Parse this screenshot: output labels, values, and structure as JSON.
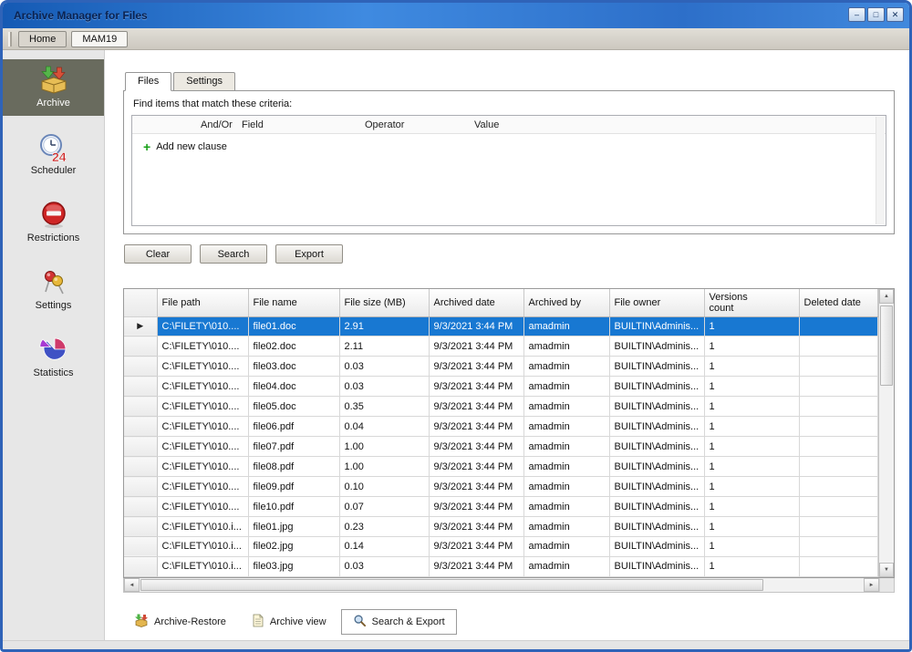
{
  "window": {
    "title": "Archive Manager for Files",
    "controls": {
      "minimize": "–",
      "maximize": "□",
      "close": "✕"
    }
  },
  "icons": {
    "scroll_up": "▲",
    "scroll_down": "▼",
    "scroll_left": "◄",
    "scroll_right": "►",
    "add_plus": "+",
    "selected_row_arrow": "▶"
  },
  "toolbar": {
    "items": [
      {
        "label": "Home"
      },
      {
        "label": "MAM19"
      }
    ]
  },
  "sidebar": {
    "items": [
      {
        "label": "Archive",
        "selected": true
      },
      {
        "label": "Scheduler",
        "selected": false
      },
      {
        "label": "Restrictions",
        "selected": false
      },
      {
        "label": "Settings",
        "selected": false
      },
      {
        "label": "Statistics",
        "selected": false
      }
    ]
  },
  "main": {
    "tabs": [
      {
        "label": "Files",
        "selected": true
      },
      {
        "label": "Settings",
        "selected": false
      }
    ],
    "criteria": {
      "label": "Find items that match these criteria:",
      "columns": [
        "And/Or",
        "Field",
        "Operator",
        "Value"
      ],
      "add_clause_label": "Add new clause"
    },
    "action_buttons": [
      {
        "label": "Clear"
      },
      {
        "label": "Search"
      },
      {
        "label": "Export"
      }
    ],
    "grid": {
      "columns": [
        "File path",
        "File name",
        "File size (MB)",
        "Archived date",
        "Archived by",
        "File owner",
        "Versions count",
        "Deleted date"
      ],
      "rows": [
        {
          "selected": true,
          "cells": [
            "C:\\FILETY\\010....",
            "file01.doc",
            "2.91",
            "9/3/2021 3:44 PM",
            "amadmin",
            "BUILTIN\\Adminis...",
            "1",
            ""
          ]
        },
        {
          "selected": false,
          "cells": [
            "C:\\FILETY\\010....",
            "file02.doc",
            "2.11",
            "9/3/2021 3:44 PM",
            "amadmin",
            "BUILTIN\\Adminis...",
            "1",
            ""
          ]
        },
        {
          "selected": false,
          "cells": [
            "C:\\FILETY\\010....",
            "file03.doc",
            "0.03",
            "9/3/2021 3:44 PM",
            "amadmin",
            "BUILTIN\\Adminis...",
            "1",
            ""
          ]
        },
        {
          "selected": false,
          "cells": [
            "C:\\FILETY\\010....",
            "file04.doc",
            "0.03",
            "9/3/2021 3:44 PM",
            "amadmin",
            "BUILTIN\\Adminis...",
            "1",
            ""
          ]
        },
        {
          "selected": false,
          "cells": [
            "C:\\FILETY\\010....",
            "file05.doc",
            "0.35",
            "9/3/2021 3:44 PM",
            "amadmin",
            "BUILTIN\\Adminis...",
            "1",
            ""
          ]
        },
        {
          "selected": false,
          "cells": [
            "C:\\FILETY\\010....",
            "file06.pdf",
            "0.04",
            "9/3/2021 3:44 PM",
            "amadmin",
            "BUILTIN\\Adminis...",
            "1",
            ""
          ]
        },
        {
          "selected": false,
          "cells": [
            "C:\\FILETY\\010....",
            "file07.pdf",
            "1.00",
            "9/3/2021 3:44 PM",
            "amadmin",
            "BUILTIN\\Adminis...",
            "1",
            ""
          ]
        },
        {
          "selected": false,
          "cells": [
            "C:\\FILETY\\010....",
            "file08.pdf",
            "1.00",
            "9/3/2021 3:44 PM",
            "amadmin",
            "BUILTIN\\Adminis...",
            "1",
            ""
          ]
        },
        {
          "selected": false,
          "cells": [
            "C:\\FILETY\\010....",
            "file09.pdf",
            "0.10",
            "9/3/2021 3:44 PM",
            "amadmin",
            "BUILTIN\\Adminis...",
            "1",
            ""
          ]
        },
        {
          "selected": false,
          "cells": [
            "C:\\FILETY\\010....",
            "file10.pdf",
            "0.07",
            "9/3/2021 3:44 PM",
            "amadmin",
            "BUILTIN\\Adminis...",
            "1",
            ""
          ]
        },
        {
          "selected": false,
          "cells": [
            "C:\\FILETY\\010.i...",
            "file01.jpg",
            "0.23",
            "9/3/2021 3:44 PM",
            "amadmin",
            "BUILTIN\\Adminis...",
            "1",
            ""
          ]
        },
        {
          "selected": false,
          "cells": [
            "C:\\FILETY\\010.i...",
            "file02.jpg",
            "0.14",
            "9/3/2021 3:44 PM",
            "amadmin",
            "BUILTIN\\Adminis...",
            "1",
            ""
          ]
        },
        {
          "selected": false,
          "cells": [
            "C:\\FILETY\\010.i...",
            "file03.jpg",
            "0.03",
            "9/3/2021 3:44 PM",
            "amadmin",
            "BUILTIN\\Adminis...",
            "1",
            ""
          ]
        }
      ]
    },
    "bottom_tabs": [
      {
        "label": "Archive-Restore",
        "selected": false
      },
      {
        "label": "Archive view",
        "selected": false
      },
      {
        "label": "Search & Export",
        "selected": true
      }
    ]
  }
}
